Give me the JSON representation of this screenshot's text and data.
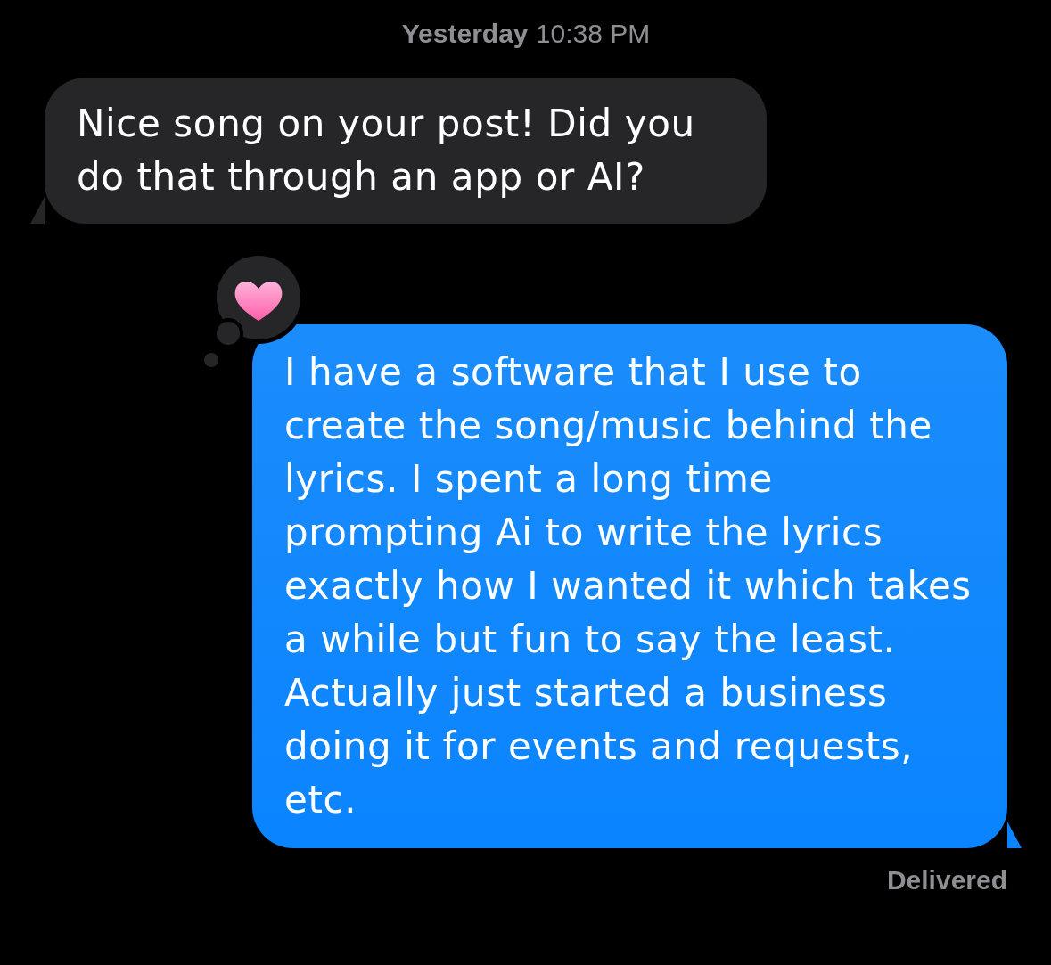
{
  "timestamp": {
    "day": "Yesterday",
    "time": "10:38 PM"
  },
  "messages": [
    {
      "kind": "incoming",
      "text": "Nice song on your post! Did you do that through an app or AI?"
    },
    {
      "kind": "outgoing",
      "text": "I have a software that I use to create the song/music behind the lyrics. I spent a long time prompting Ai to write the lyrics exactly how I wanted it which takes a while but fun to say the least.\nActually just started a business doing it for events and requests, etc.",
      "reaction": {
        "kind": "heart"
      }
    }
  ],
  "status": "Delivered"
}
